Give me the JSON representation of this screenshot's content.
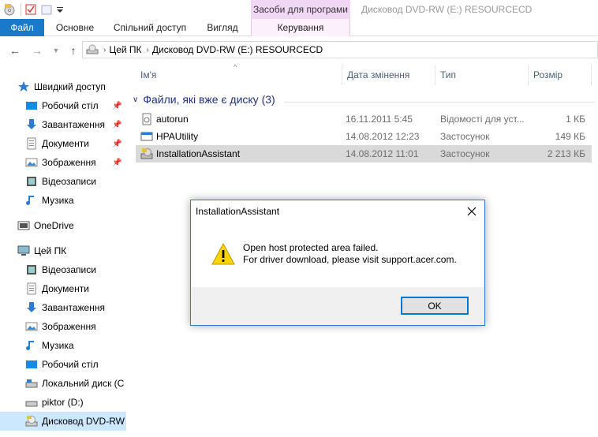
{
  "window": {
    "title": "Дисковод DVD-RW (E:) RESOURCECD",
    "tools_header": "Засоби для програми"
  },
  "ribbon": {
    "tabs": [
      {
        "label": "Файл"
      },
      {
        "label": "Основне"
      },
      {
        "label": "Спільний доступ"
      },
      {
        "label": "Вигляд"
      },
      {
        "label": "Керування"
      }
    ]
  },
  "address": {
    "crumbs": [
      "Цей ПК",
      "Дисковод DVD-RW (E:) RESOURCECD"
    ]
  },
  "sidebar": {
    "items": [
      {
        "label": "Швидкий доступ",
        "icon": "star-icon"
      },
      {
        "label": "Робочий стіл",
        "icon": "desktop-icon",
        "pinned": true
      },
      {
        "label": "Завантаження",
        "icon": "download-icon",
        "pinned": true
      },
      {
        "label": "Документи",
        "icon": "documents-icon",
        "pinned": true
      },
      {
        "label": "Зображення",
        "icon": "pictures-icon",
        "pinned": true
      },
      {
        "label": "Відеозаписи",
        "icon": "videos-icon"
      },
      {
        "label": "Музика",
        "icon": "music-icon"
      },
      {
        "label": "OneDrive",
        "icon": "onedrive-icon"
      },
      {
        "label": "Цей ПК",
        "icon": "computer-icon"
      },
      {
        "label": "Відеозаписи",
        "icon": "videos-icon"
      },
      {
        "label": "Документи",
        "icon": "documents-icon"
      },
      {
        "label": "Завантаження",
        "icon": "download-icon"
      },
      {
        "label": "Зображення",
        "icon": "pictures-icon"
      },
      {
        "label": "Музика",
        "icon": "music-icon"
      },
      {
        "label": "Робочий стіл",
        "icon": "desktop-icon"
      },
      {
        "label": "Локальний диск (C",
        "icon": "drive-icon"
      },
      {
        "label": "piktor (D:)",
        "icon": "drive-icon"
      },
      {
        "label": "Дисковод DVD-RW",
        "icon": "dvd-icon",
        "selected": true
      }
    ]
  },
  "columns": {
    "name": "Ім'я",
    "date": "Дата змінення",
    "type": "Тип",
    "size": "Розмір"
  },
  "group": {
    "title": "Файли, які вже є диску (3)"
  },
  "files": [
    {
      "name": "autorun",
      "date": "16.11.2011 5:45",
      "type": "Відомості для уст...",
      "size": "1 КБ"
    },
    {
      "name": "HPAUtility",
      "date": "14.08.2012 12:23",
      "type": "Застосунок",
      "size": "149 КБ"
    },
    {
      "name": "InstallationAssistant",
      "date": "14.08.2012 11:01",
      "type": "Застосунок",
      "size": "2 213 КБ",
      "selected": true
    }
  ],
  "dialog": {
    "title": "InstallationAssistant",
    "message_line1": "Open host protected area failed.",
    "message_line2": "For driver download, please visit support.acer.com.",
    "ok_label": "OK"
  },
  "colors": {
    "accent": "#1979ca",
    "selection": "#cce8ff",
    "tools_tab": "#f0d8f4",
    "warning": "#ffd700"
  }
}
